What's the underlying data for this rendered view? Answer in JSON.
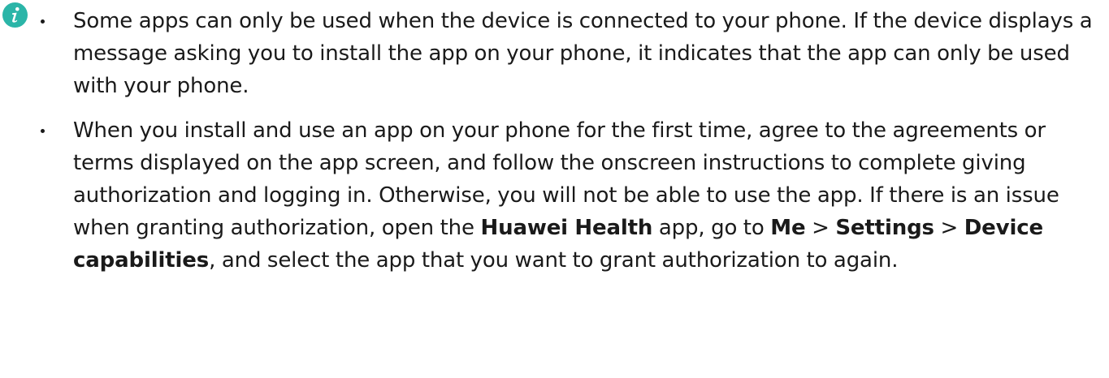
{
  "note": {
    "icon": "info-icon",
    "icon_color": "#2bb5a8",
    "items": [
      {
        "text": "Some apps can only be used when the device is connected to your phone. If the device displays a message asking you to install the app on your phone, it indicates that the app can only be used with your phone."
      },
      {
        "text_1": "When you install and use an app on your phone for the first time, agree to the agreements or terms displayed on the app screen, and follow the onscreen instructions to complete giving authorization and logging in. Otherwise, you will not be able to use the app. If there is an issue when granting authorization, open the ",
        "app_name": "Huawei Health",
        "text_2": " app, go to ",
        "path_1": "Me",
        "sep_1": " > ",
        "path_2": "Settings",
        "sep_2": " > ",
        "path_3": "Device capabilities",
        "text_3": ", and select the app that you want to grant authorization to again."
      }
    ]
  }
}
